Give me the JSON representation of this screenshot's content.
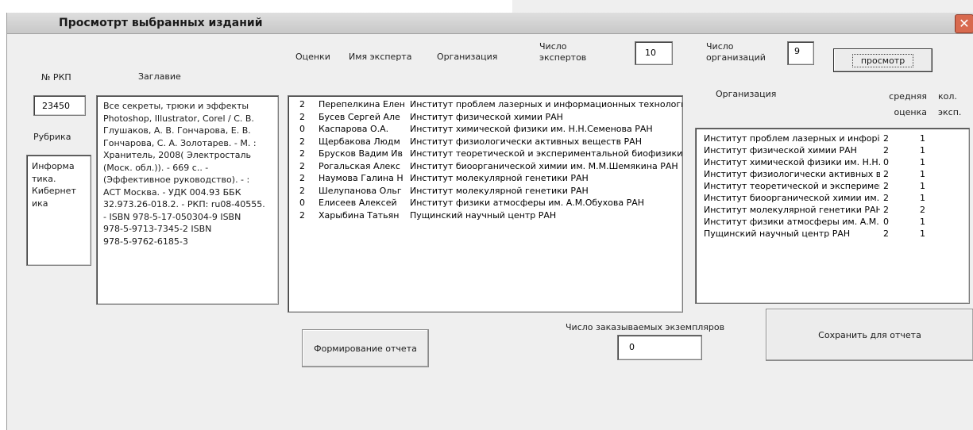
{
  "window": {
    "title": "Просмотрт выбранных изданий",
    "close_glyph": "✕",
    "close_icon": "close-icon"
  },
  "left": {
    "rkp_label": "№ РКП",
    "rkp_value": "23450",
    "title_label": "Заглавие",
    "title_text": "Все секреты, трюки и эффекты\nPhotoshop, Illustrator, Corel / С. В.\nГлушаков, А. В. Гончарова, Е. В.\nГончарова, С. А. Золотарев. - М. :\nХранитель, 2008( Электросталь\n(Моск. обл.)). - 669 с.. -\n(Эффективное руководство). - :\nАСТ Москва. - УДК 004.93 ББК\n32.973.26-018.2. - РКП: ru08-40555.\n- ISBN 978-5-17-050304-9 ISBN\n978-5-9713-7345-2 ISBN\n978-5-9762-6185-3",
    "rubric_label": "Рубрика",
    "rubric_text": "Информа\nтика.\nКибернет\nика"
  },
  "experts": {
    "col_scores": "Оценки",
    "col_name": "Имя эксперта",
    "col_org": "Организация",
    "count_label": "Число\nэкспертов",
    "count_value": "10",
    "rows": [
      {
        "score": "2",
        "name": "Перепелкина Елен",
        "org": "Институт проблем лазерных и информационных технологий"
      },
      {
        "score": "2",
        "name": "Бусев Сергей Але",
        "org": "Институт физической химии РАН"
      },
      {
        "score": "0",
        "name": "Каспарова О.А.",
        "org": "Институт химической физики им. Н.Н.Семенова РАН"
      },
      {
        "score": "2",
        "name": "Щербакова Людм",
        "org": "Институт физиологически активных веществ РАН"
      },
      {
        "score": "2",
        "name": "Брусков Вадим Ив",
        "org": "Институт теоретической и экспериментальной биофизики Р"
      },
      {
        "score": "2",
        "name": "Рогальская Алекс",
        "org": "Институт биоорганической химии им. М.М.Шемякина РАН"
      },
      {
        "score": "2",
        "name": "Наумова Галина Н",
        "org": "Институт молекулярной генетики РАН"
      },
      {
        "score": "2",
        "name": "Шелупанова Ольг",
        "org": "Институт молекулярной генетики РАН"
      },
      {
        "score": "0",
        "name": "Елисеев Алексей",
        "org": "Институт физики атмосферы им. А.М.Обухова РАН"
      },
      {
        "score": "2",
        "name": "Харыбина Татьян",
        "org": "Пущинский научный центр РАН"
      }
    ]
  },
  "orgs": {
    "count_label": "Число\nорганизаций",
    "count_value": "9",
    "view_button": "просмотр",
    "col_org": "Организация",
    "col_avg": "средняя\nоценка",
    "col_cnt": "кол.\nэксп.",
    "rows": [
      {
        "org": "Институт проблем лазерных и инфорі",
        "avg": "2",
        "cnt": "1"
      },
      {
        "org": "Институт физической химии РАН",
        "avg": "2",
        "cnt": "1"
      },
      {
        "org": "Институт химической физики им. Н.Н.",
        "avg": "0",
        "cnt": "1"
      },
      {
        "org": "Институт физиологически активных в",
        "avg": "2",
        "cnt": "1"
      },
      {
        "org": "Институт теоретической и эксперимен",
        "avg": "2",
        "cnt": "1"
      },
      {
        "org": "Институт биоорганической химии им.",
        "avg": "2",
        "cnt": "1"
      },
      {
        "org": "Институт молекулярной генетики РАН",
        "avg": "2",
        "cnt": "2"
      },
      {
        "org": "Институт физики атмосферы им. А.М.",
        "avg": "0",
        "cnt": "1"
      },
      {
        "org": "Пущинский научный центр РАН",
        "avg": "2",
        "cnt": "1"
      }
    ]
  },
  "bottom": {
    "report_button": "Формирование отчета",
    "copies_label": "Число заказываемых экземпляров",
    "copies_value": "0",
    "save_button": "Сохранить для отчета"
  }
}
